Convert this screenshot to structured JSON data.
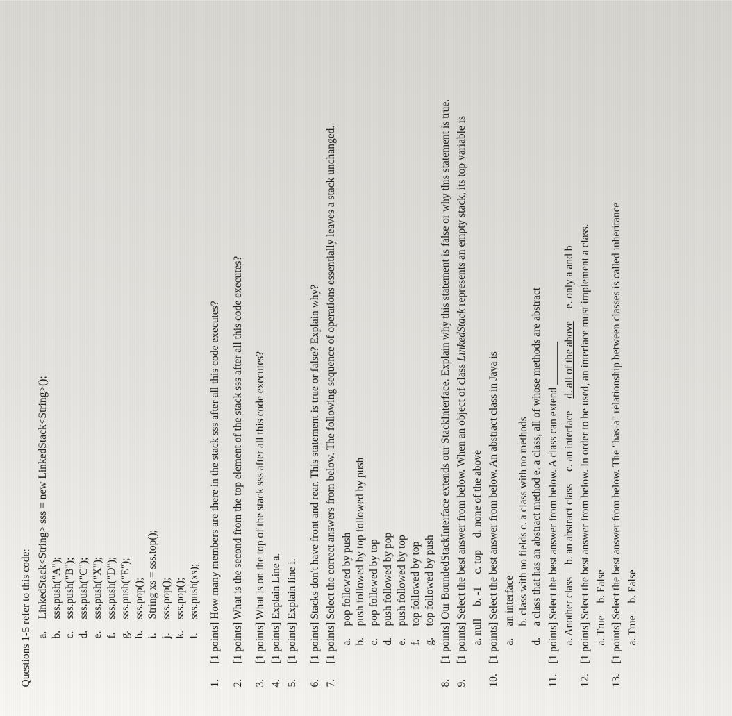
{
  "intro": "Questions 1-5 refer to this code:",
  "code_lines": [
    {
      "letter": "a.",
      "text": "LinkedStack<String> sss = new LinkedStack<String>();"
    },
    {
      "letter": "b.",
      "text": "sss.push(\"A\");"
    },
    {
      "letter": "c.",
      "text": "sss.push(\"B\");"
    },
    {
      "letter": "d.",
      "text": "sss.push(\"C\");"
    },
    {
      "letter": "e.",
      "text": "sss.push(\"X\");"
    },
    {
      "letter": "f.",
      "text": "sss.push(\"D\");"
    },
    {
      "letter": "g.",
      "text": "sss.push(\"E\");"
    },
    {
      "letter": "h.",
      "text": "sss.pop();"
    },
    {
      "letter": "i.",
      "text": "String xs = sss.top();"
    },
    {
      "letter": "j.",
      "text": "sss.pop();"
    },
    {
      "letter": "k.",
      "text": "sss.pop();"
    },
    {
      "letter": "l.",
      "text": "sss.push(xs);"
    }
  ],
  "q1": {
    "num": "1.",
    "pts": "[1 points]",
    "text": " How many members are there in the stack sss after all this code executes?"
  },
  "q2": {
    "num": "2.",
    "pts": "[1 points]",
    "text": " What is the second from the top element of the stack sss after all this code executes?"
  },
  "q3": {
    "num": "3.",
    "pts": "[1 points]",
    "text": " What is on the top of the stack sss after all this code executes?"
  },
  "q4": {
    "num": "4.",
    "pts": "[1 points]",
    "text": " Explain Line a."
  },
  "q5": {
    "num": "5.",
    "pts": "[1 points]",
    "text": " Explain line i."
  },
  "q6": {
    "num": "6.",
    "pts": "[1 points]",
    "text": " Stacks don't have front and rear. This statement is true or false? Explain why?"
  },
  "q7": {
    "num": "7.",
    "pts": "[1 points]",
    "text": " Select the correct answers from below. The following sequence of operations essentially leaves a stack unchanged."
  },
  "q7_opts": [
    {
      "letter": "a.",
      "text": "pop followed by push"
    },
    {
      "letter": "b.",
      "text": "push followed by top followed by push"
    },
    {
      "letter": "c.",
      "text": "pop followed by top"
    },
    {
      "letter": "d.",
      "text": "push followed by pop"
    },
    {
      "letter": "e.",
      "text": "push followed by top"
    },
    {
      "letter": "f.",
      "text": "top followed by top"
    },
    {
      "letter": "g.",
      "text": "top followed by push"
    }
  ],
  "q8": {
    "num": "8.",
    "pts": "[1 points]",
    "text_a": " Our BoundedStackInterface extends our StackInterface. Explain why this statement is false or why this statement is true."
  },
  "q9": {
    "num": "9.",
    "pts": "[1 points]",
    "text_a": " Select the best answer from below. When an object of class ",
    "italic": "LinkedStack",
    "text_b": " represents an empty stack, its top variable is"
  },
  "q9_opts": {
    "a": "a. null",
    "b": "b. -1",
    "c": "c. top",
    "d": "d. none of the above"
  },
  "q10": {
    "num": "10.",
    "pts": "[1 points]",
    "text": " Select the best answer from below. An abstract class in Java is"
  },
  "q10_opts": [
    {
      "letter": "a.",
      "text": "an interface"
    },
    {
      "letter": "",
      "text": "b. class with no fields        c. a class with no methods"
    },
    {
      "letter": "d.",
      "text": "a class that has an abstract method   e. a class, all of whose methods are abstract"
    }
  ],
  "q11": {
    "num": "11.",
    "pts": "[1 points]",
    "text": " Select the best answer from below. A class can extend ________"
  },
  "q11_opts": {
    "a": "a. Another class",
    "b": "b. an abstract class",
    "c": "c. an interface",
    "d": "d. all of the above",
    "e": "e. only a and b"
  },
  "q12": {
    "num": "12.",
    "pts": "[1 points]",
    "text": " Select the best answer from below. In order to be used, an interface must implement a class."
  },
  "q12_opts": {
    "a": "a. True",
    "b": "b. False"
  },
  "q13": {
    "num": "13.",
    "pts": "[1 points]",
    "text": " Select the best answer from below. The \"has-a\" relationship between classes is called inheritance"
  },
  "q13_opts": {
    "a": "a. True",
    "b": "b. False"
  }
}
